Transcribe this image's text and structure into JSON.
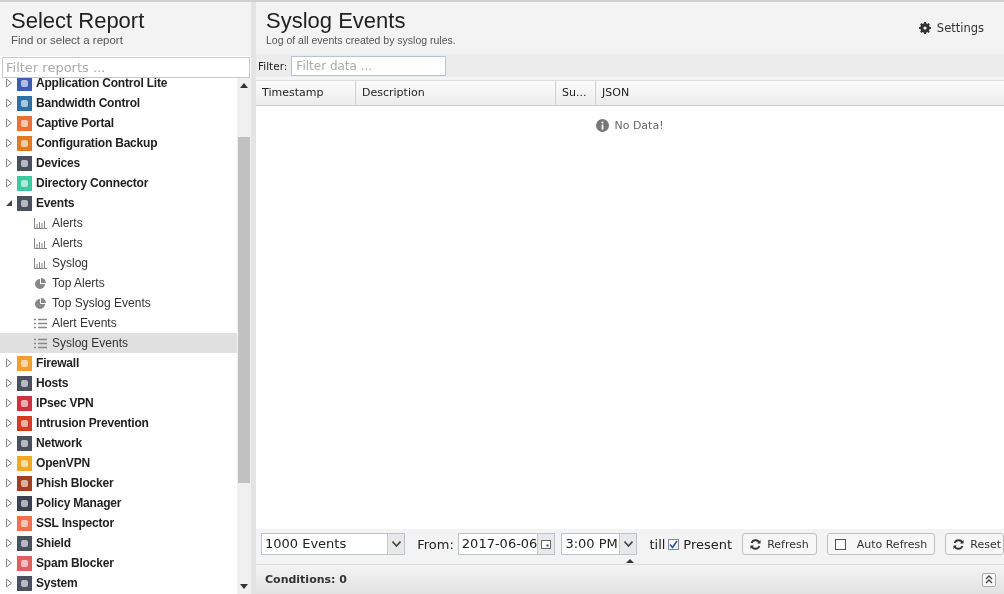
{
  "sidebar": {
    "title": "Select Report",
    "subtitle": "Find or select a report",
    "filter": {
      "placeholder": "Filter reports ..."
    },
    "tree": [
      {
        "label": "Application Control Lite",
        "expanded": false,
        "selected": false,
        "color": "#3a5fb0"
      },
      {
        "label": "Bandwidth Control",
        "expanded": false,
        "selected": false,
        "color": "#2f6fa8"
      },
      {
        "label": "Captive Portal",
        "expanded": false,
        "selected": false,
        "color": "#e8703a"
      },
      {
        "label": "Configuration Backup",
        "expanded": false,
        "selected": false,
        "color": "#e07a20"
      },
      {
        "label": "Devices",
        "expanded": false,
        "selected": false,
        "color": "#4a5060"
      },
      {
        "label": "Directory Connector",
        "expanded": false,
        "selected": false,
        "color": "#3cc8a0"
      },
      {
        "label": "Events",
        "expanded": true,
        "selected": false,
        "color": "#4a5060",
        "children": [
          {
            "label": "Alerts",
            "kind": "bar",
            "selected": false
          },
          {
            "label": "Alerts",
            "kind": "bar",
            "selected": false
          },
          {
            "label": "Syslog",
            "kind": "bar",
            "selected": false
          },
          {
            "label": "Top Alerts",
            "kind": "pie",
            "selected": false
          },
          {
            "label": "Top Syslog Events",
            "kind": "pie",
            "selected": false
          },
          {
            "label": "Alert Events",
            "kind": "list",
            "selected": false
          },
          {
            "label": "Syslog Events",
            "kind": "list",
            "selected": true
          }
        ]
      },
      {
        "label": "Firewall",
        "expanded": false,
        "selected": false,
        "color": "#f0a030"
      },
      {
        "label": "Hosts",
        "expanded": false,
        "selected": false,
        "color": "#4a5060"
      },
      {
        "label": "IPsec VPN",
        "expanded": false,
        "selected": false,
        "color": "#d03040"
      },
      {
        "label": "Intrusion Prevention",
        "expanded": false,
        "selected": false,
        "color": "#d83a20"
      },
      {
        "label": "Network",
        "expanded": false,
        "selected": false,
        "color": "#4a5060"
      },
      {
        "label": "OpenVPN",
        "expanded": false,
        "selected": false,
        "color": "#f0a820"
      },
      {
        "label": "Phish Blocker",
        "expanded": false,
        "selected": false,
        "color": "#a04020"
      },
      {
        "label": "Policy Manager",
        "expanded": false,
        "selected": false,
        "color": "#3a4050"
      },
      {
        "label": "SSL Inspector",
        "expanded": false,
        "selected": false,
        "color": "#f07050"
      },
      {
        "label": "Shield",
        "expanded": false,
        "selected": false,
        "color": "#4a5060"
      },
      {
        "label": "Spam Blocker",
        "expanded": false,
        "selected": false,
        "color": "#e06060"
      },
      {
        "label": "System",
        "expanded": false,
        "selected": false,
        "color": "#4a5060"
      }
    ]
  },
  "report": {
    "title": "Syslog Events",
    "subtitle": "Log of all events created by syslog rules.",
    "settings": "Settings",
    "filter": {
      "label": "Filter:",
      "placeholder": "Filter data ..."
    },
    "columns": [
      "Timestamp",
      "Description",
      "Su...",
      "JSON"
    ],
    "empty_message": "No Data!",
    "toolbar": {
      "limit": "1000 Events",
      "from_label": "From:",
      "date": "2017-06-06",
      "time": "3:00 PM",
      "till_label": "till",
      "present": {
        "label": "Present",
        "checked": true
      },
      "refresh": "Refresh",
      "auto_refresh": {
        "label": "Auto Refresh",
        "checked": false
      },
      "reset": "Reset"
    },
    "conditions": "Conditions: 0"
  }
}
